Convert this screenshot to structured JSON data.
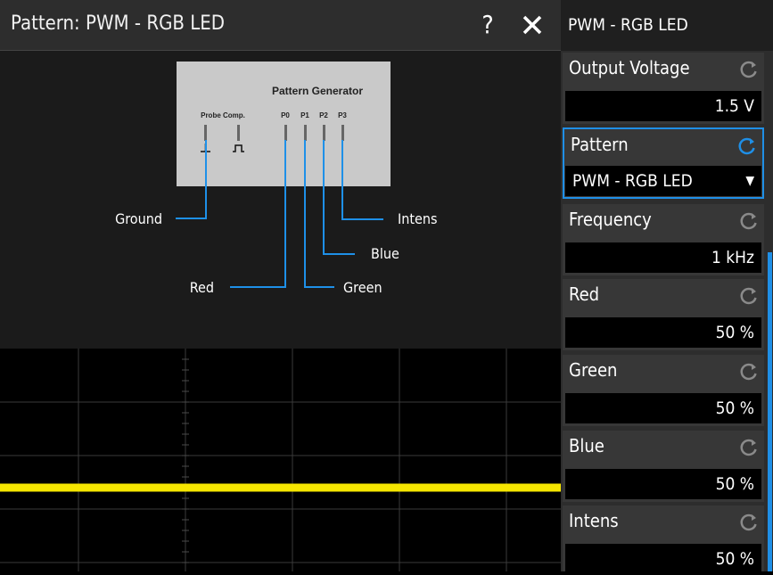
{
  "dialog": {
    "title": "Pattern: PWM - RGB LED",
    "help_glyph": "?",
    "close_glyph": "✕"
  },
  "diagram": {
    "generator_title": "Pattern Generator",
    "probe_comp_label": "Probe Comp.",
    "pins": [
      "P0",
      "P1",
      "P2",
      "P3"
    ],
    "signals": {
      "ground": "Ground",
      "red": "Red",
      "green": "Green",
      "blue": "Blue",
      "intens": "Intens"
    },
    "colors": {
      "line": "#1e90e8",
      "box": "#c8c8c8"
    }
  },
  "scope": {
    "trace_color": "#f5e600",
    "grid_color": "#3a3a3a"
  },
  "panel": {
    "title": "PWM - RGB LED",
    "params": [
      {
        "label": "Output Voltage",
        "value": "1.5 V"
      },
      {
        "label": "Pattern",
        "value": "PWM - RGB LED",
        "selected": true
      },
      {
        "label": "Frequency",
        "value": "1 kHz"
      },
      {
        "label": "Red",
        "value": "50 %"
      },
      {
        "label": "Green",
        "value": "50 %"
      },
      {
        "label": "Blue",
        "value": "50 %"
      },
      {
        "label": "Intens",
        "value": "50 %"
      }
    ],
    "accent_color": "#1f8fe6"
  }
}
